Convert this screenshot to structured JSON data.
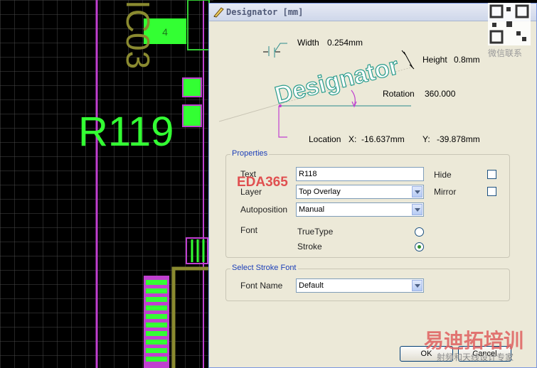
{
  "pcb": {
    "component_big_label": "R119",
    "component_vertical_label": "IC03",
    "pad_label": "4"
  },
  "dialog": {
    "title": "Designator [mm]",
    "diagram": {
      "sample_text": "Designator",
      "width_label": "Width",
      "width_value": "0.254mm",
      "height_label": "Height",
      "height_value": "0.8mm",
      "rotation_label": "Rotation",
      "rotation_value": "360.000",
      "location_label": "Location",
      "x_label": "X:",
      "x_value": "-16.637mm",
      "y_label": "Y:",
      "y_value": "-39.878mm"
    },
    "properties": {
      "legend": "Properties",
      "text_label": "Text",
      "text_value": "R118",
      "layer_label": "Layer",
      "layer_value": "Top Overlay",
      "autoposition_label": "Autoposition",
      "autoposition_value": "Manual",
      "font_label": "Font",
      "font_truetype": "TrueType",
      "font_stroke": "Stroke",
      "font_selected": "Stroke",
      "hide_label": "Hide",
      "hide_checked": false,
      "mirror_label": "Mirror",
      "mirror_checked": false
    },
    "stroke_font": {
      "legend": "Select Stroke Font",
      "font_name_label": "Font Name",
      "font_name_value": "Default"
    },
    "buttons": {
      "ok": "OK",
      "cancel": "Cancel"
    }
  },
  "watermarks": {
    "eda": "EDA365",
    "cn_big": "易迪拓培训",
    "cn_small": "射频和天线设计专家",
    "wechat": "微信联系"
  },
  "colors": {
    "pcb_grid": "#5a5a5a",
    "pcb_overlay_green": "#33ff33",
    "pcb_track_magenta": "#c040d0",
    "pcb_olive": "#8a8a30",
    "dialog_bg": "#ece9d8",
    "diagram_teal": "#2a8c8c",
    "legend_blue": "#1c3fb8"
  }
}
